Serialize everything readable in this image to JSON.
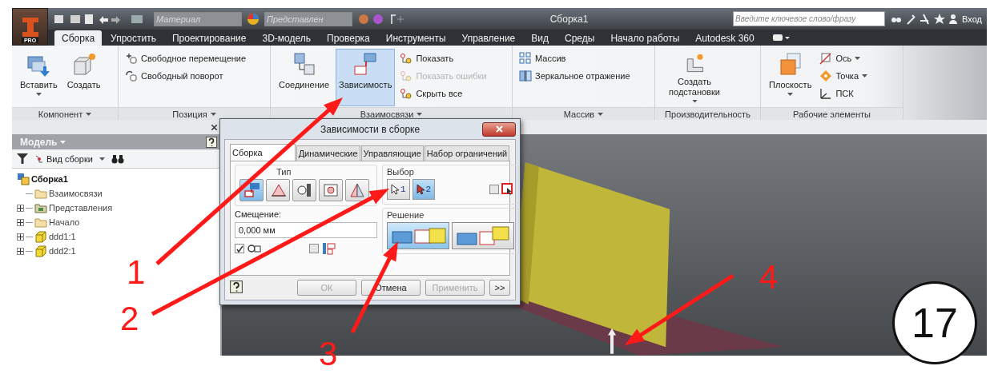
{
  "app": {
    "badge": "PRO",
    "material": {
      "placeholder": "Материал"
    },
    "appearance": {
      "placeholder": "Представлен"
    },
    "document_title": "Сборка1",
    "search": {
      "placeholder": "Введите ключевое слово/фразу"
    },
    "sign_in": "Вход"
  },
  "ribbon_tabs": [
    {
      "label": "Сборка",
      "selected": true
    },
    {
      "label": "Упростить",
      "selected": false
    },
    {
      "label": "Проектирование",
      "selected": false
    },
    {
      "label": "3D-модель",
      "selected": false
    },
    {
      "label": "Проверка",
      "selected": false
    },
    {
      "label": "Инструменты",
      "selected": false
    },
    {
      "label": "Управление",
      "selected": false
    },
    {
      "label": "Вид",
      "selected": false
    },
    {
      "label": "Среды",
      "selected": false
    },
    {
      "label": "Начало работы",
      "selected": false
    },
    {
      "label": "Autodesk 360",
      "selected": false
    }
  ],
  "ribbon_panels": [
    {
      "title": "Компонент",
      "menu": true,
      "items": [
        {
          "kind": "large",
          "label": "Вставить",
          "menu": true,
          "selected": false,
          "disabled": false
        },
        {
          "kind": "large",
          "label": "Создать",
          "menu": false,
          "selected": false,
          "disabled": false
        }
      ]
    },
    {
      "title": "Позиция",
      "menu": true,
      "items": [
        {
          "kind": "small",
          "label": "Свободное перемещение",
          "menu": false,
          "selected": false,
          "disabled": false
        },
        {
          "kind": "small",
          "label": "Свободный поворот",
          "menu": false,
          "selected": false,
          "disabled": false
        }
      ]
    },
    {
      "title": "Взаимосвязи",
      "menu": true,
      "items": [
        {
          "kind": "large",
          "label": "Соединение",
          "menu": false,
          "selected": false,
          "disabled": false
        },
        {
          "kind": "large",
          "label": "Зависимость",
          "menu": false,
          "selected": true,
          "disabled": false
        },
        {
          "kind": "small",
          "label": "Показать",
          "menu": false,
          "selected": false,
          "disabled": false
        },
        {
          "kind": "small",
          "label": "Показать ошибки",
          "menu": false,
          "selected": false,
          "disabled": true
        },
        {
          "kind": "small",
          "label": "Скрыть все",
          "menu": false,
          "selected": false,
          "disabled": false
        }
      ]
    },
    {
      "title": "Массив",
      "menu": true,
      "items": [
        {
          "kind": "small",
          "label": "Массив",
          "menu": false,
          "selected": false,
          "disabled": false
        },
        {
          "kind": "small",
          "label": "Зеркальное отражение",
          "menu": false,
          "selected": false,
          "disabled": false
        }
      ]
    },
    {
      "title": "Производительность",
      "menu": false,
      "items": [
        {
          "kind": "large",
          "label": "Создать подстановки",
          "menu": true,
          "selected": false,
          "disabled": false
        }
      ]
    },
    {
      "title": "Рабочие элементы",
      "menu": false,
      "items": [
        {
          "kind": "large",
          "label": "Плоскость",
          "menu": true,
          "selected": false,
          "disabled": false
        },
        {
          "kind": "small",
          "label": "Ось",
          "menu": true,
          "selected": false,
          "disabled": false
        },
        {
          "kind": "small",
          "label": "Точка",
          "menu": true,
          "selected": false,
          "disabled": false
        },
        {
          "kind": "small",
          "label": "ПСК",
          "menu": false,
          "selected": false,
          "disabled": false
        }
      ]
    }
  ],
  "browser": {
    "title": "Модель",
    "view": "Вид сборки",
    "tree": [
      {
        "label": "Сборка1",
        "kind": "assembly",
        "collapsed": false,
        "children": [
          {
            "label": "Взаимосвязи",
            "kind": "folder",
            "collapsed": false
          },
          {
            "label": "Представления",
            "kind": "views",
            "collapsed": true
          },
          {
            "label": "Начало",
            "kind": "folder",
            "collapsed": true
          },
          {
            "label": "ddd1:1",
            "kind": "part",
            "collapsed": true
          },
          {
            "label": "ddd2:1",
            "kind": "part",
            "collapsed": true
          }
        ]
      }
    ]
  },
  "dialog": {
    "title": "Зависимости в сборке",
    "tabs": [
      {
        "label": "Сборка",
        "selected": true
      },
      {
        "label": "Динамические",
        "selected": false
      },
      {
        "label": "Управляющие",
        "selected": false
      },
      {
        "label": "Набор ограничений",
        "selected": false
      }
    ],
    "type_group": {
      "title": "Тип",
      "options": [
        {
          "selected": true
        },
        {
          "selected": false
        },
        {
          "selected": false
        },
        {
          "selected": false
        },
        {
          "selected": false
        }
      ]
    },
    "selection_group": {
      "title": "Выбор",
      "picks": [
        {
          "label": "1",
          "selected": false
        },
        {
          "label": "2",
          "selected": true
        }
      ],
      "preselect": {
        "checked": false
      }
    },
    "offset": {
      "label": "Смещение:",
      "value": "0,000 мм"
    },
    "solution_group": {
      "title": "Решение",
      "options": [
        {
          "selected": true
        },
        {
          "selected": false
        }
      ]
    },
    "options": [
      {
        "checked": true
      },
      {
        "checked": false
      }
    ],
    "buttons": [
      {
        "label": "ОК",
        "disabled": true
      },
      {
        "label": "Отмена",
        "disabled": false
      },
      {
        "label": "Применить",
        "disabled": true
      },
      {
        "label": ">>",
        "disabled": false
      }
    ]
  },
  "callouts": [
    {
      "label": "1"
    },
    {
      "label": "2"
    },
    {
      "label": "3"
    },
    {
      "label": "4"
    }
  ],
  "slide_number": "17"
}
